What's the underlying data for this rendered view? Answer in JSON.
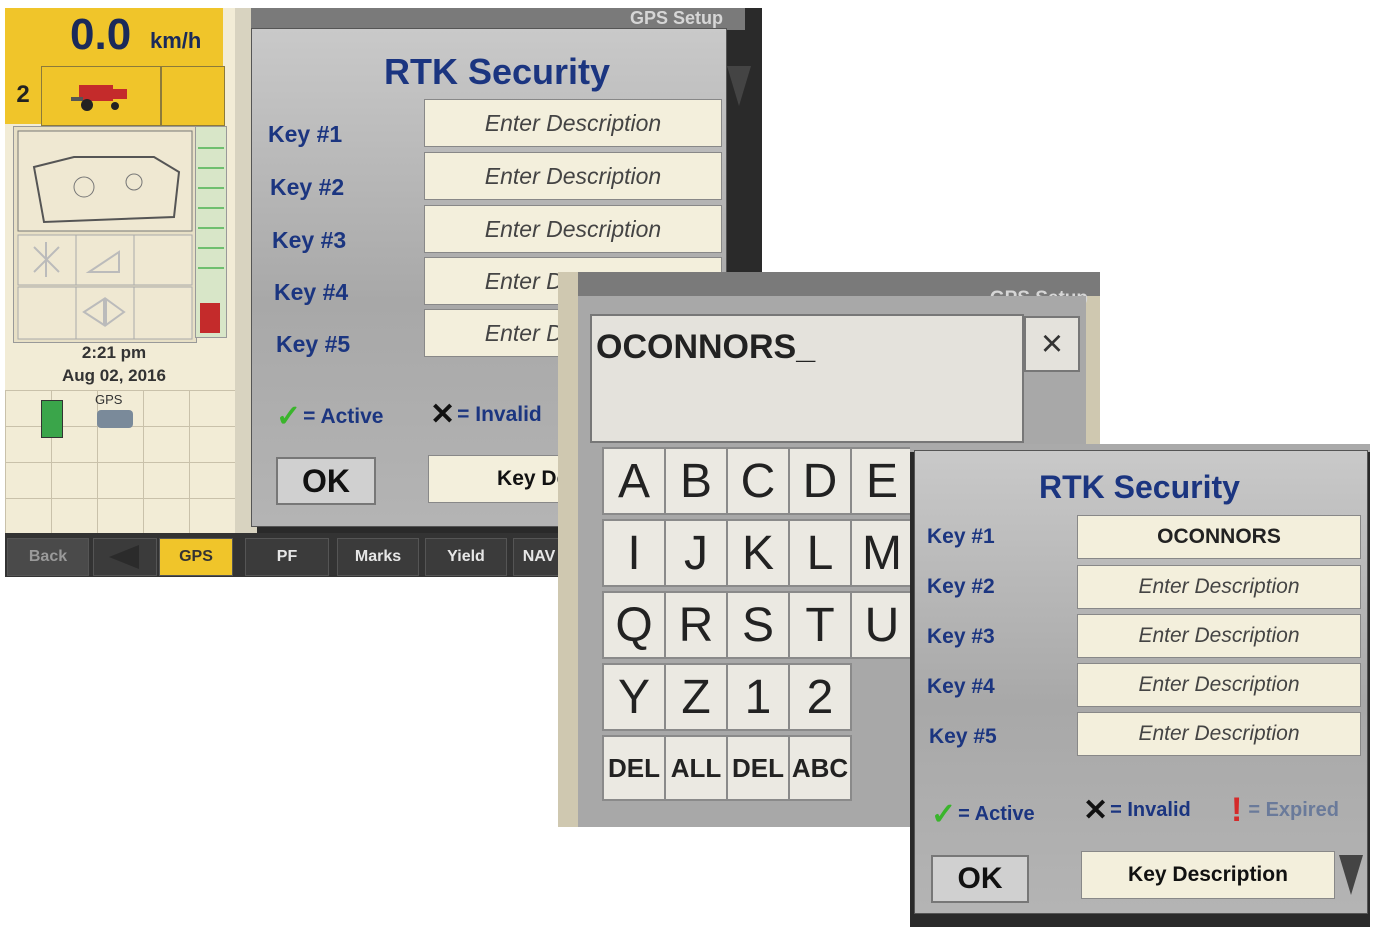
{
  "screen1": {
    "speed_value": "0.0",
    "speed_unit": "km/h",
    "gear": "2",
    "time": "2:21 pm",
    "date": "Aug 02, 2016",
    "gps_label": "GPS",
    "header_title": "GPS Setup",
    "dialog_title": "RTK Security",
    "keys": [
      {
        "label": "Key #1",
        "value": "Enter Description"
      },
      {
        "label": "Key #2",
        "value": "Enter Description"
      },
      {
        "label": "Key #3",
        "value": "Enter Description"
      },
      {
        "label": "Key #4",
        "value": "Enter Description"
      },
      {
        "label": "Key #5",
        "value": "Enter Description"
      }
    ],
    "legend_active": "= Active",
    "legend_invalid": "= Invalid",
    "ok_label": "OK",
    "key_description_label": "Key Description",
    "tabs": [
      "Back",
      "GPS",
      "PF",
      "Marks",
      "Yield",
      "NAV"
    ]
  },
  "screen2": {
    "header_title": "GPS Setup",
    "input_value": "OCONNORS_",
    "close_symbol": "×",
    "keys_row1": [
      "A",
      "B",
      "C",
      "D",
      "E"
    ],
    "keys_row2": [
      "I",
      "J",
      "K",
      "L",
      "M"
    ],
    "keys_row3": [
      "Q",
      "R",
      "S",
      "T",
      "U"
    ],
    "keys_row4": [
      "Y",
      "Z",
      "1",
      "2"
    ],
    "keys_row5": [
      "DEL",
      "ALL",
      "DEL",
      "ABC"
    ]
  },
  "screen3": {
    "dialog_title": "RTK Security",
    "keys": [
      {
        "label": "Key #1",
        "value": "OCONNORS"
      },
      {
        "label": "Key #2",
        "value": "Enter Description"
      },
      {
        "label": "Key #3",
        "value": "Enter Description"
      },
      {
        "label": "Key #4",
        "value": "Enter Description"
      },
      {
        "label": "Key #5",
        "value": "Enter Description"
      }
    ],
    "legend_active": "= Active",
    "legend_invalid": "= Invalid",
    "legend_expired": "= Expired",
    "ok_label": "OK",
    "key_description_label": "Key Description"
  },
  "colors": {
    "title_blue": "#1b3580",
    "field_bg": "#f3efdc",
    "panel_gray": "#b4b4b4",
    "status_yellow": "#f0c52a",
    "check_green": "#3ab52c",
    "expired_red": "#d42a2a"
  },
  "icons": [
    "combine-icon",
    "check-icon",
    "x-icon",
    "exclamation-icon",
    "close-icon",
    "dropdown-arrow-icon",
    "back-arrow-icon",
    "fuel-icon",
    "gps-satellite-icon"
  ]
}
